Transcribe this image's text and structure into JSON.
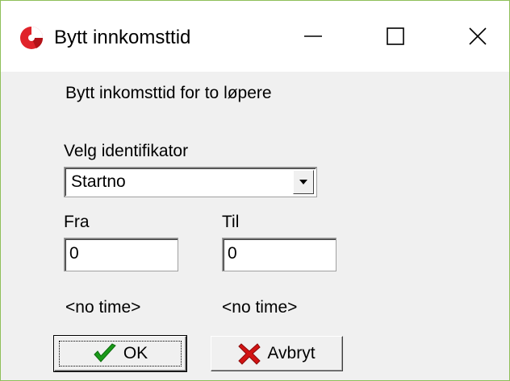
{
  "window": {
    "title": "Bytt innkomsttid",
    "icon": "app-logo-icon",
    "controls": {
      "minimize": "minimize-icon",
      "maximize": "maximize-icon",
      "close": "close-icon"
    }
  },
  "form": {
    "description": "Bytt inkomsttid for to løpere",
    "identifier_label": "Velg identifikator",
    "identifier_selected": "Startno",
    "from_label": "Fra",
    "from_value": "0",
    "to_label": "Til",
    "to_value": "0",
    "from_time": "<no time>",
    "to_time": "<no time>"
  },
  "buttons": {
    "ok_label": "OK",
    "ok_icon": "checkmark-icon",
    "cancel_label": "Avbryt",
    "cancel_icon": "red-x-icon"
  },
  "colors": {
    "window_border": "#8fbf5a",
    "dialog_bg": "#f0f0f0",
    "check_green": "#1a9a1a",
    "cancel_red": "#d21414",
    "logo_red": "#e0232a"
  }
}
